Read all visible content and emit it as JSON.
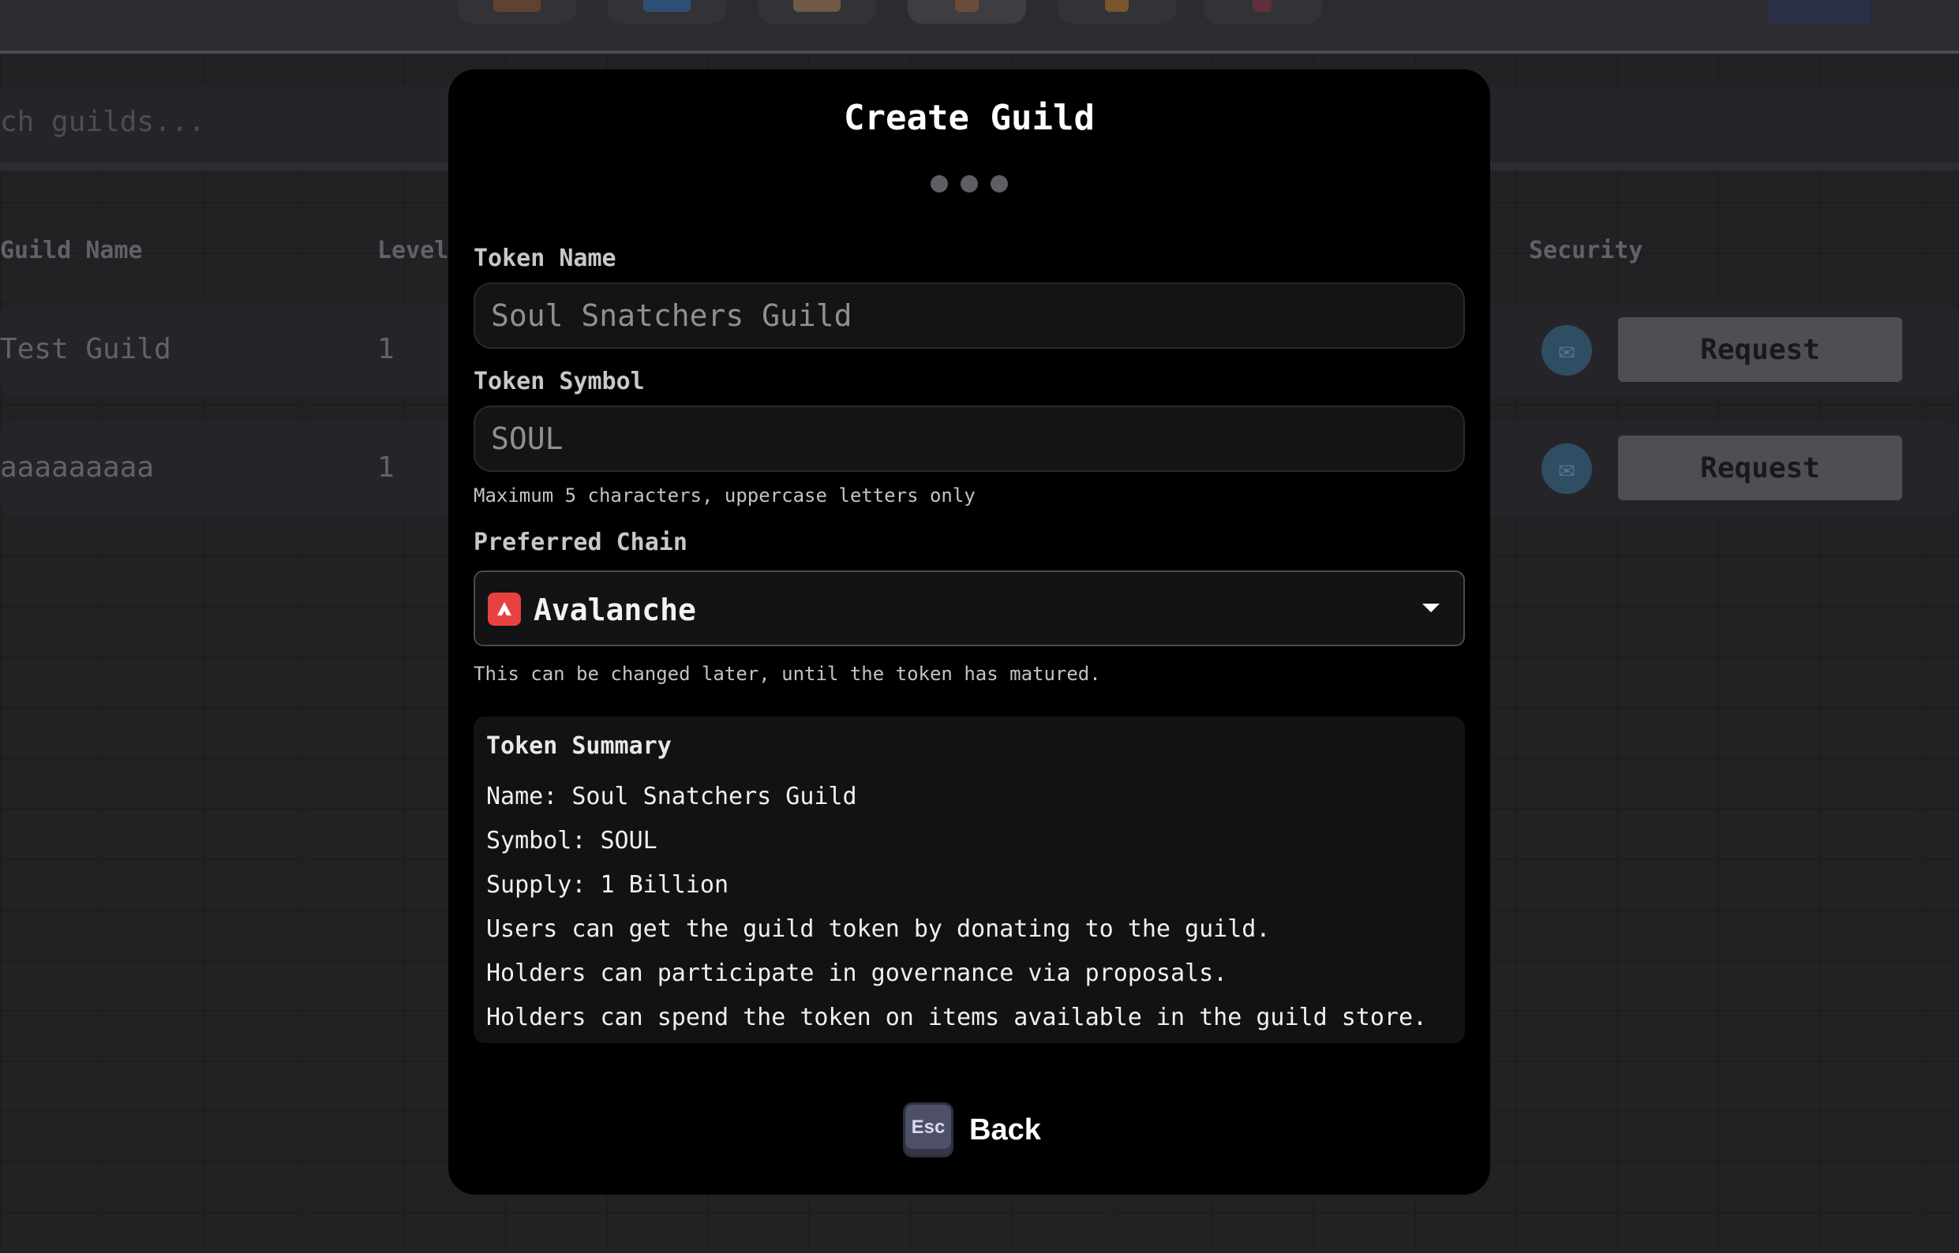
{
  "background": {
    "search": {
      "placeholder_visible": "ch guilds..."
    },
    "table": {
      "headers": {
        "guild_name": "Guild Name",
        "level": "Level",
        "security": "Security"
      },
      "rows": [
        {
          "name": "Test Guild",
          "level": "1",
          "action": "Request"
        },
        {
          "name": "aaaaaaaaa",
          "level": "1",
          "action": "Request"
        }
      ]
    }
  },
  "modal": {
    "title": "Create Guild",
    "steps": {
      "total": 3
    },
    "token_name": {
      "label": "Token Name",
      "value": "Soul Snatchers Guild"
    },
    "token_symbol": {
      "label": "Token Symbol",
      "value": "SOUL",
      "hint": "Maximum 5 characters, uppercase letters only"
    },
    "preferred_chain": {
      "label": "Preferred Chain",
      "selected": "Avalanche",
      "hint": "This can be changed later, until the token has matured."
    },
    "summary": {
      "title": "Token Summary",
      "lines": [
        "Name: Soul Snatchers Guild",
        "Symbol: SOUL",
        "Supply: 1 Billion",
        "Users can get the guild token by donating to the guild.",
        "Holders can participate in governance via proposals.",
        "Holders can spend the token on items available in the guild store."
      ]
    },
    "back": {
      "key": "Esc",
      "label": "Back"
    }
  },
  "colors": {
    "modal_bg": "#000000",
    "avalanche_red": "#e84142",
    "request_button": "#6e6e74",
    "security_icon": "#3e6d8e"
  },
  "icons": {
    "chain": "avalanche-logo-icon",
    "dropdown": "chevron-down-icon",
    "security": "shield-icon",
    "back_key": "esc-key-icon"
  }
}
